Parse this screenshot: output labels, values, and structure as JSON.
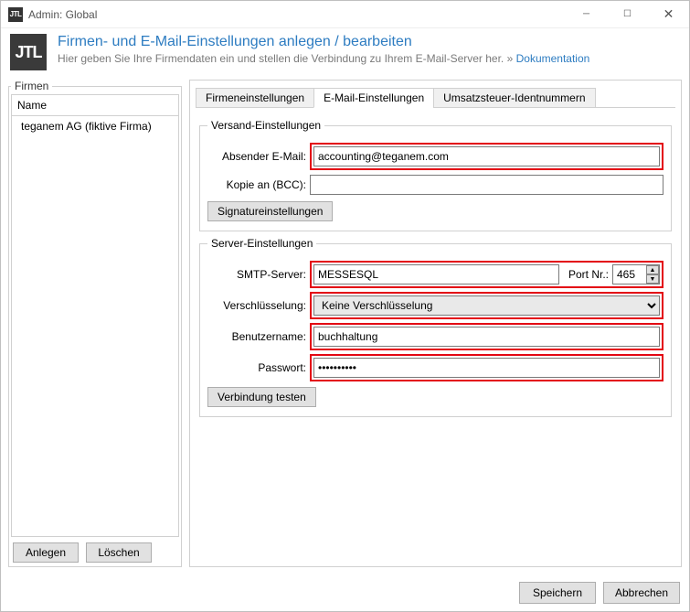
{
  "window": {
    "title": "Admin: Global"
  },
  "header": {
    "logo_text": "JTL",
    "title": "Firmen- und E-Mail-Einstellungen anlegen / bearbeiten",
    "subtitle_pre": "Hier geben Sie Ihre Firmendaten ein und stellen die Verbindung zu Ihrem E-Mail-Server her. » ",
    "doc_link": "Dokumentation"
  },
  "sidebar": {
    "legend": "Firmen",
    "col_name": "Name",
    "rows": [
      "teganem AG (fiktive Firma)"
    ],
    "btn_add": "Anlegen",
    "btn_del": "Löschen"
  },
  "tabs": {
    "t0": "Firmeneinstellungen",
    "t1": "E-Mail-Einstellungen",
    "t2": "Umsatzsteuer-Identnummern"
  },
  "versand": {
    "legend": "Versand-Einstellungen",
    "sender_label": "Absender E-Mail:",
    "sender_value": "accounting@teganem.com",
    "bcc_label": "Kopie an (BCC):",
    "bcc_value": "",
    "sig_btn": "Signatureinstellungen"
  },
  "server": {
    "legend": "Server-Einstellungen",
    "smtp_label": "SMTP-Server:",
    "smtp_value": "MESSESQL",
    "port_label": "Port Nr.:",
    "port_value": "465",
    "enc_label": "Verschlüsselung:",
    "enc_value": "Keine Verschlüsselung",
    "user_label": "Benutzername:",
    "user_value": "buchhaltung",
    "pass_label": "Passwort:",
    "pass_value": "••••••••••",
    "test_btn": "Verbindung testen"
  },
  "footer": {
    "save": "Speichern",
    "cancel": "Abbrechen"
  }
}
